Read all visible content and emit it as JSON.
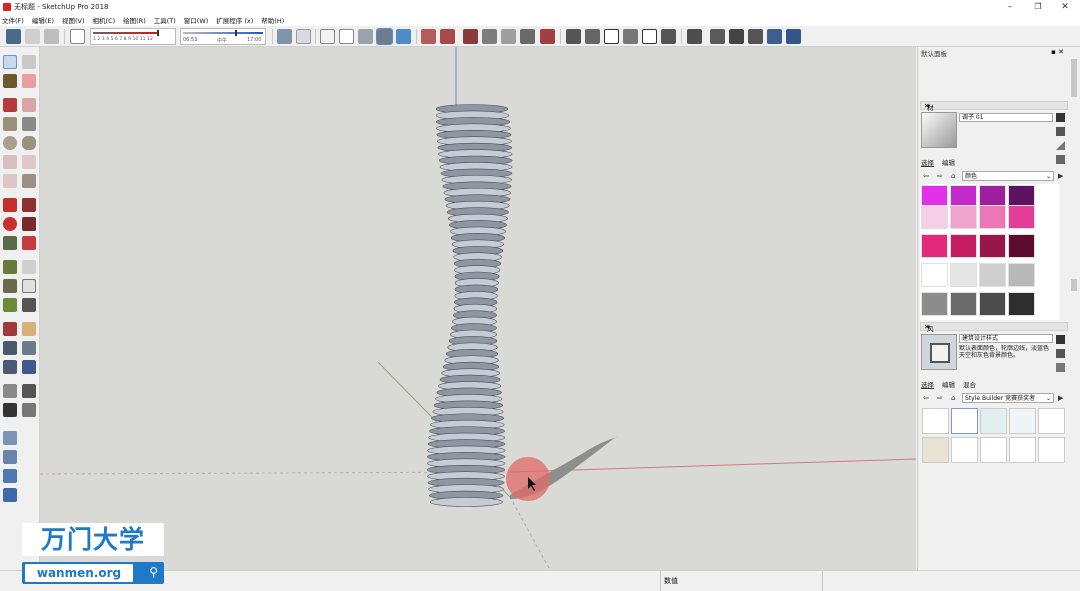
{
  "window": {
    "title": "无标题 - SketchUp Pro 2018",
    "minimize": "–",
    "restore": "❐",
    "close": "✕"
  },
  "menu": [
    "文件(F)",
    "编辑(E)",
    "视图(V)",
    "相机(C)",
    "绘图(R)",
    "工具(T)",
    "窗口(W)",
    "扩展程序 (x)",
    "帮助(H)"
  ],
  "toolbar": {
    "shadow_slider_ticks": "1 2 3 4 5 6 7 8 9 10 11 12",
    "time_slider_start": "06:53",
    "time_slider_mid": "中午",
    "time_slider_end": "17:00"
  },
  "status": {
    "measurements_label": "数值"
  },
  "tray": {
    "title": "默认面板",
    "materials": {
      "header": "材料",
      "name_value": "调子 01",
      "tabs": [
        "选择",
        "编辑"
      ],
      "active_tab": 0,
      "library_value": "颜色",
      "swatches": [
        "#e231e8",
        "#c42ac9",
        "#9d1f9e",
        "#5e1362",
        "#f5cfe3",
        "#f1a4cb",
        "#ec76b6",
        "#e43d97",
        "#e32a7a",
        "#c41c5f",
        "#99164a",
        "#5c0d2d",
        "#ffffff",
        "#e6e6e6",
        "#cfcfcf",
        "#b8b8b8",
        "#8c8c8c",
        "#6b6b6b",
        "#4c4c4c",
        "#2f2f2f"
      ]
    },
    "styles": {
      "header": "风格",
      "name_value": "建筑设计样式",
      "description": "默认表面颜色，轮廓边线，淡蓝色天空和灰色背景颜色。",
      "tabs": [
        "选择",
        "编辑",
        "混合"
      ],
      "active_tab": 0,
      "library_value": "Style Builder 竞赛获奖者"
    }
  },
  "watermark": {
    "logo_text": "万门大学",
    "url_text": "wanmen.org",
    "search_glyph": "⚲"
  }
}
